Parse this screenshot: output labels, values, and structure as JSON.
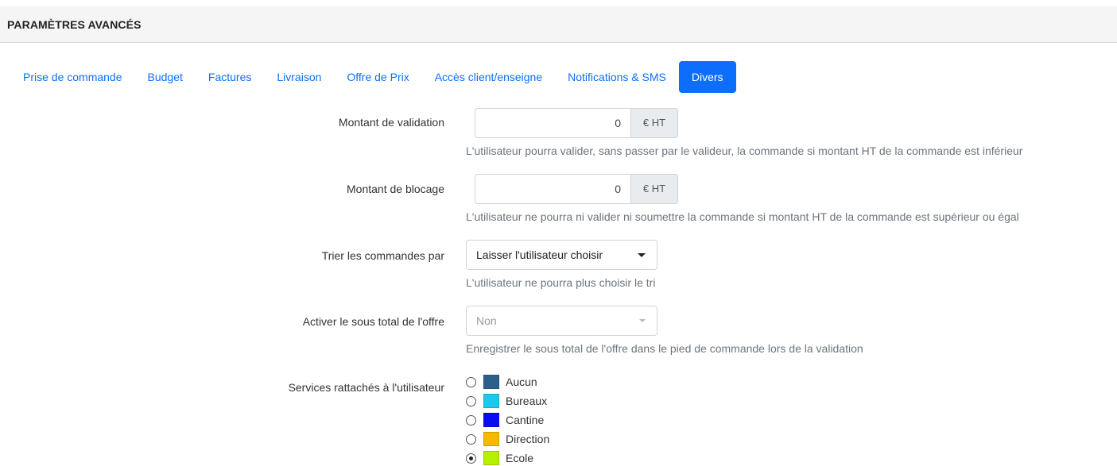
{
  "header": {
    "title": "PARAMÈTRES AVANCÉS"
  },
  "tabs": [
    {
      "label": "Prise de commande",
      "active": false
    },
    {
      "label": "Budget",
      "active": false
    },
    {
      "label": "Factures",
      "active": false
    },
    {
      "label": "Livraison",
      "active": false
    },
    {
      "label": "Offre de Prix",
      "active": false
    },
    {
      "label": "Accès client/enseigne",
      "active": false
    },
    {
      "label": "Notifications & SMS",
      "active": false
    },
    {
      "label": "Divers",
      "active": true
    }
  ],
  "form": {
    "validation": {
      "label": "Montant de validation",
      "value": "0",
      "unit": "€ HT",
      "help": "L'utilisateur pourra valider, sans passer par le valideur, la commande si montant HT de la commande est inférieur"
    },
    "blocage": {
      "label": "Montant de blocage",
      "value": "0",
      "unit": "€ HT",
      "help": "L'utilisateur ne pourra ni valider ni soumettre la commande si montant HT de la commande est supérieur ou égal"
    },
    "tri": {
      "label": "Trier les commandes par",
      "selected": "Laisser l'utilisateur choisir",
      "help": "L'utilisateur ne pourra plus choisir le tri"
    },
    "sous_total": {
      "label": "Activer le sous total de l'offre",
      "selected": "Non",
      "disabled": true,
      "help": "Enregistrer le sous total de l'offre dans le pied de commande lors de la validation"
    },
    "services": {
      "label": "Services rattachés à l'utilisateur",
      "options": [
        {
          "label": "Aucun",
          "color": "#2e5f8a",
          "checked": false
        },
        {
          "label": "Bureaux",
          "color": "#1ec8ec",
          "checked": false
        },
        {
          "label": "Cantine",
          "color": "#0b0bf0",
          "checked": false
        },
        {
          "label": "Direction",
          "color": "#f6b800",
          "checked": false
        },
        {
          "label": "Ecole",
          "color": "#b6f000",
          "checked": true
        }
      ]
    }
  }
}
